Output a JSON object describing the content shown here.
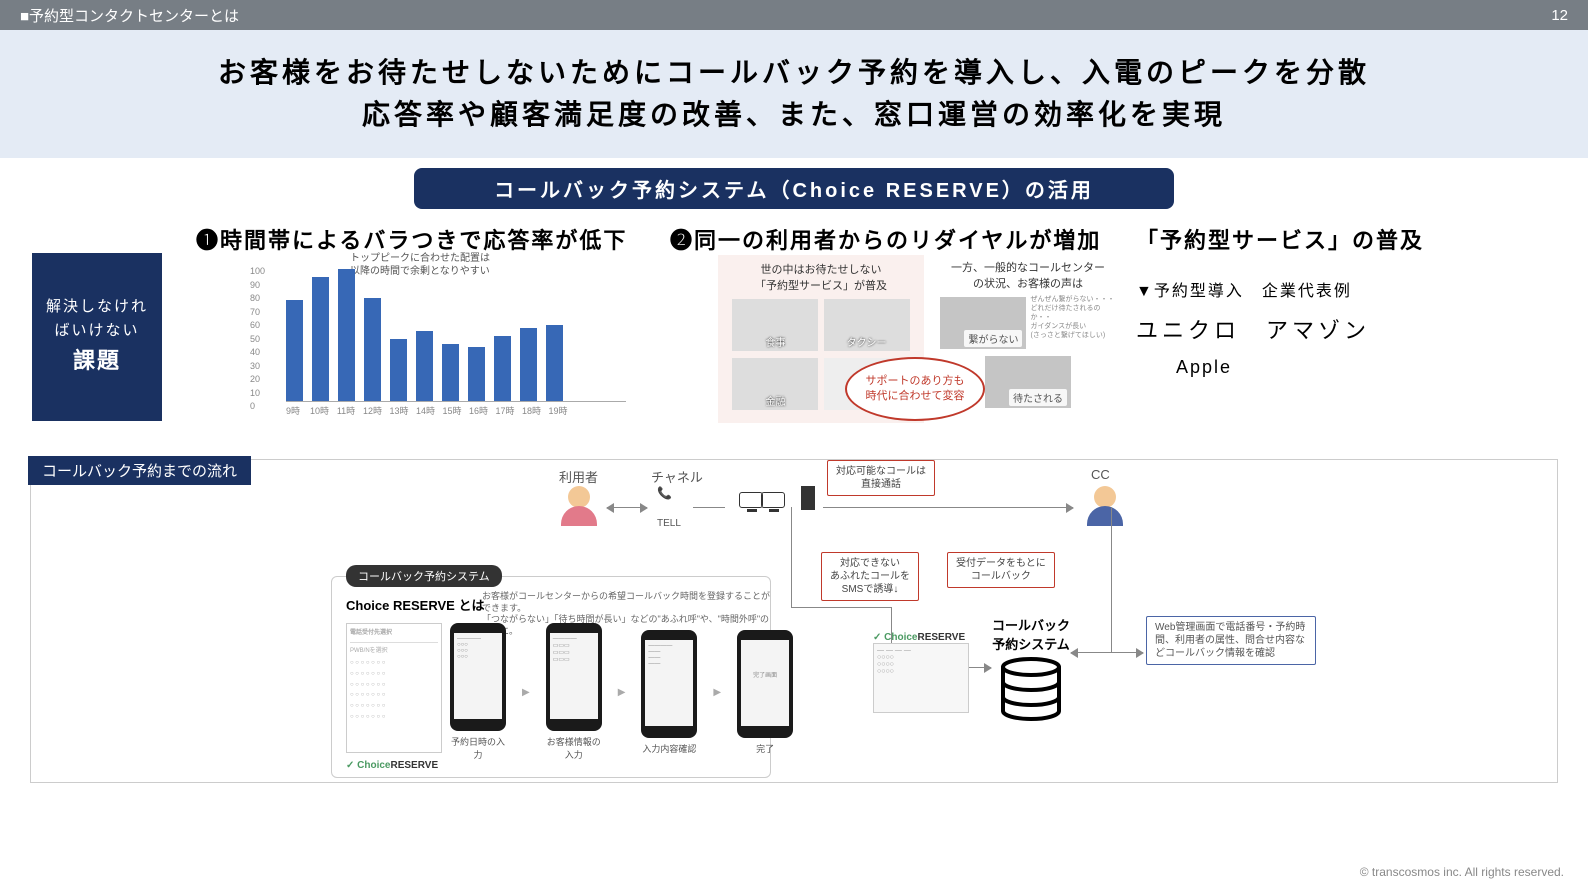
{
  "topbar": {
    "title": "■予約型コンタクトセンターとは",
    "page": "12"
  },
  "hero": {
    "line1": "お客様をお待たせしないためにコールバック予約を導入し、入電のピークを分散",
    "line2": "応答率や顧客満足度の改善、また、窓口運営の効率化を実現"
  },
  "pill": "コールバック予約システム（Choice RESERVE）の活用",
  "sidebox": {
    "l1": "解決しなけれ",
    "l2": "ばいけない",
    "big": "課題"
  },
  "p1": {
    "title": "❶時間帯によるバラつきで応答率が低下",
    "note1": "トップピークに合わせた配置は",
    "note2": "以降の時間で余剰となりやすい"
  },
  "chart_data": {
    "type": "bar",
    "categories": [
      "9時",
      "10時",
      "11時",
      "12時",
      "13時",
      "14時",
      "15時",
      "16時",
      "17時",
      "18時",
      "19時"
    ],
    "values": [
      75,
      92,
      98,
      76,
      46,
      52,
      42,
      40,
      48,
      54,
      56
    ],
    "ylim": [
      0,
      100
    ],
    "yticks": [
      0,
      10,
      20,
      30,
      40,
      50,
      60,
      70,
      80,
      90,
      100
    ]
  },
  "p2": {
    "title": "❷同一の利用者からのリダイヤルが増加",
    "panelL": {
      "t1": "世の中はお待たせしない",
      "t2": "「予約型サービス」が普及",
      "imgs": [
        "食事",
        "タクシー",
        "金融",
        ""
      ]
    },
    "panelR": {
      "t1": "一方、一般的なコールセンター",
      "t2": "の状況、お客様の声は",
      "imgs": [
        "繋がらない",
        "待たされる"
      ],
      "mini1": "ぜんぜん繋がらない・・・",
      "mini2": "どれだけ待たされるのか・・",
      "mini3": "ガイダンスが長い",
      "mini4": "(さっさと繋げてほしい)"
    },
    "circ": {
      "l1": "サポートのあり方も",
      "l2": "時代に合わせて変容"
    }
  },
  "right": {
    "title": "「予約型サービス」の普及",
    "sub": "▼予約型導入　企業代表例",
    "c1": "ユニクロ",
    "c2": "アマゾン",
    "c3": "Apple"
  },
  "flow": {
    "label": "コールバック予約までの流れ",
    "user": "利用者",
    "channel": "チャネル",
    "cc": "CC",
    "tell": "TELL",
    "co1": {
      "l1": "対応可能なコールは",
      "l2": "直接通話"
    },
    "co2": {
      "l1": "対応できない",
      "l2": "あふれたコールを",
      "l3": "SMSで誘導↓"
    },
    "co3": {
      "l1": "受付データをもとに",
      "l2": "コールバック"
    },
    "co4": {
      "l1": "Web管理画面で電話番号・予約時",
      "l2": "間、利用者の属性、問合せ内容な",
      "l3": "どコールバック情報を確認"
    },
    "db": {
      "t1": "コールバック",
      "t2": "予約システム"
    },
    "crlogo_pre": "✓ Choice",
    "crlogo_r": "RESERVE"
  },
  "chbox": {
    "tab": "コールバック予約システム",
    "lead": "Choice RESERVE とは",
    "lead2a": "お客様がコールセンターからの希望コールバック時間を登録することができます。",
    "lead2b": "「つながらない」「待ち時間が長い」などの\"あふれ呼\"や、\"時間外呼\"の対策に。",
    "cap1": "予約日時の入力",
    "cap2": "お客様情報の入力",
    "cap3": "入力内容確認",
    "cap4": "完了",
    "done": "完了画面",
    "crlogo_pre": "✓ Choice",
    "crlogo_r": "RESERVE",
    "admin_title": "電話受付先選択"
  },
  "footer": "© transcosmos inc. All rights reserved."
}
